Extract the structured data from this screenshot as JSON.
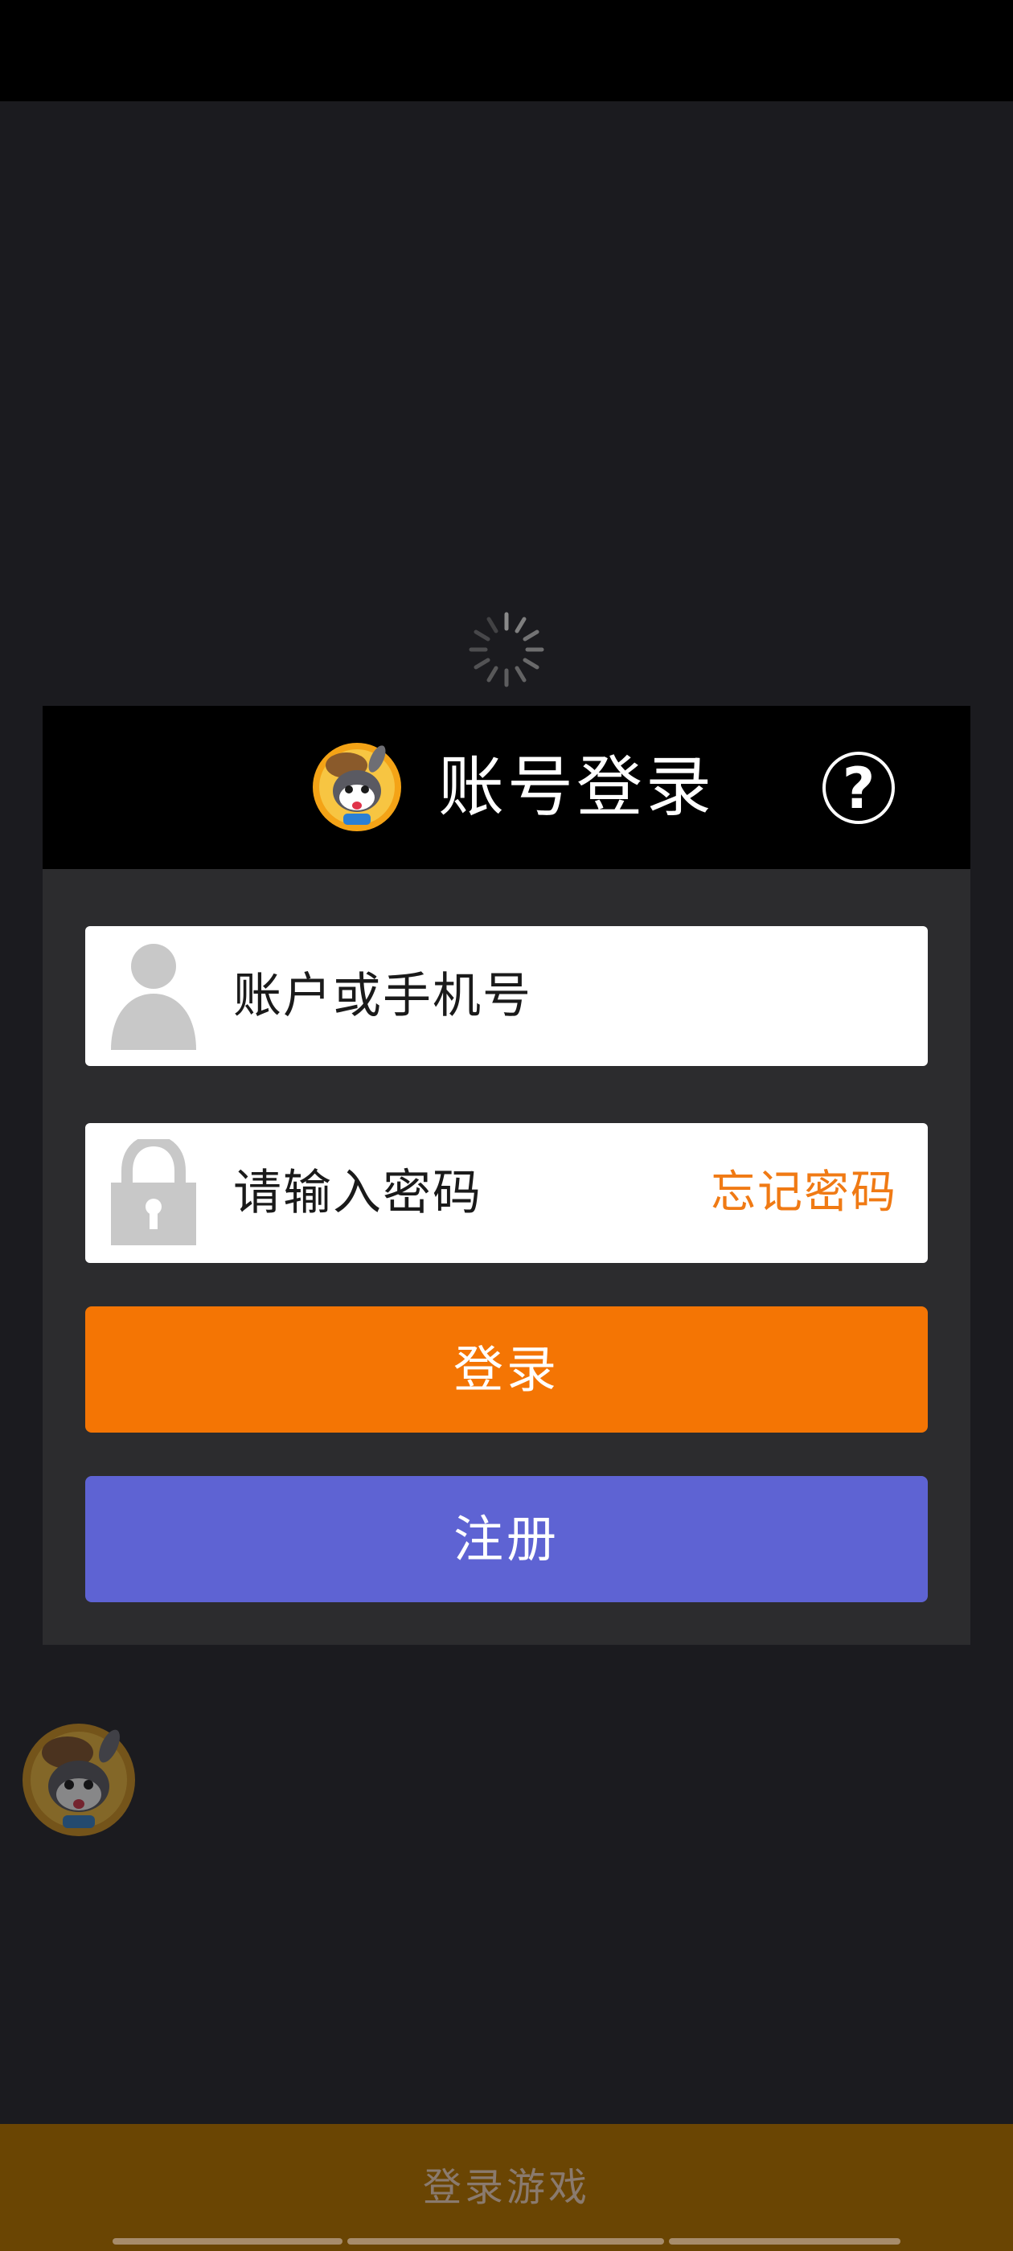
{
  "dialog": {
    "title": "账号登录",
    "help_label": "?",
    "account_placeholder": "账户或手机号",
    "password_placeholder": "请输入密码",
    "forgot_password": "忘记密码",
    "login_button": "登录",
    "register_button": "注册"
  },
  "bottom_bar": {
    "label": "登录游戏"
  },
  "colors": {
    "accent_orange": "#f47504",
    "register_purple": "#5e63d3",
    "forgot_link": "#f07a14",
    "bottom_bar": "#6a4503"
  },
  "icons": {
    "spinner": "loading-spinner-icon",
    "logo": "mascot-logo-icon",
    "help": "question-mark-icon",
    "user": "user-icon",
    "lock": "lock-icon",
    "floating": "floating-mascot-icon"
  }
}
